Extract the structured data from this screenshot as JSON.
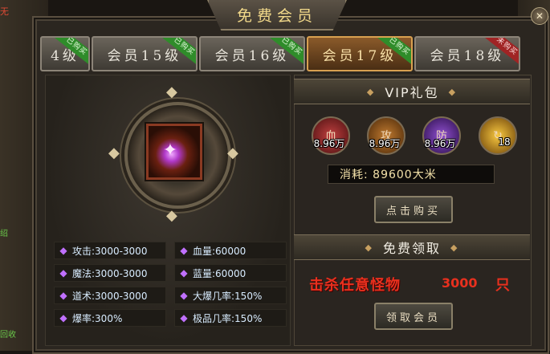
{
  "window": {
    "title": "免费会员",
    "close_glyph": "✕"
  },
  "edge_texts": {
    "top_left": "无",
    "mid_left": "绍",
    "bottom_left": "回收"
  },
  "tabs": [
    {
      "label": "4级",
      "ribbon": "已购买",
      "ribbon_color": "#2f8c2a",
      "active": false
    },
    {
      "label": "会员15级",
      "ribbon": "已购买",
      "ribbon_color": "#2f8c2a",
      "active": false
    },
    {
      "label": "会员16级",
      "ribbon": "已购买",
      "ribbon_color": "#2f8c2a",
      "active": false
    },
    {
      "label": "会员17级",
      "ribbon": "已购买",
      "ribbon_color": "#2f8c2a",
      "active": true
    },
    {
      "label": "会员18级",
      "ribbon": "未购买",
      "ribbon_color": "#a02424",
      "active": false
    }
  ],
  "attributes": [
    {
      "label": "攻击:3000-3000"
    },
    {
      "label": "血量:60000"
    },
    {
      "label": "魔法:3000-3000"
    },
    {
      "label": "蓝量:60000"
    },
    {
      "label": "道术:3000-3000"
    },
    {
      "label": "大爆几率:150%"
    },
    {
      "label": "爆率:300%"
    },
    {
      "label": "极品几率:150%"
    }
  ],
  "vip_gift": {
    "heading": "VIP礼包",
    "items": [
      {
        "glyph": "血",
        "count": "8.96万",
        "color": "#8a2020",
        "icon": "blood-potion-icon"
      },
      {
        "glyph": "攻",
        "count": "8.96万",
        "color": "#8a4a1a",
        "icon": "attack-potion-icon"
      },
      {
        "glyph": "防",
        "count": "8.96万",
        "color": "#5a2a8a",
        "icon": "defense-potion-icon"
      },
      {
        "glyph": "↻",
        "count": "18",
        "color": "#c8901a",
        "icon": "gold-scroll-icon"
      }
    ],
    "cost_label": "消耗: 89600大米",
    "buy_button": "点击购买"
  },
  "free_claim": {
    "heading": "免费领取",
    "requirement": "击杀任意怪物",
    "kill_count": "3000",
    "unit": "只",
    "claim_button": "领取会员"
  }
}
